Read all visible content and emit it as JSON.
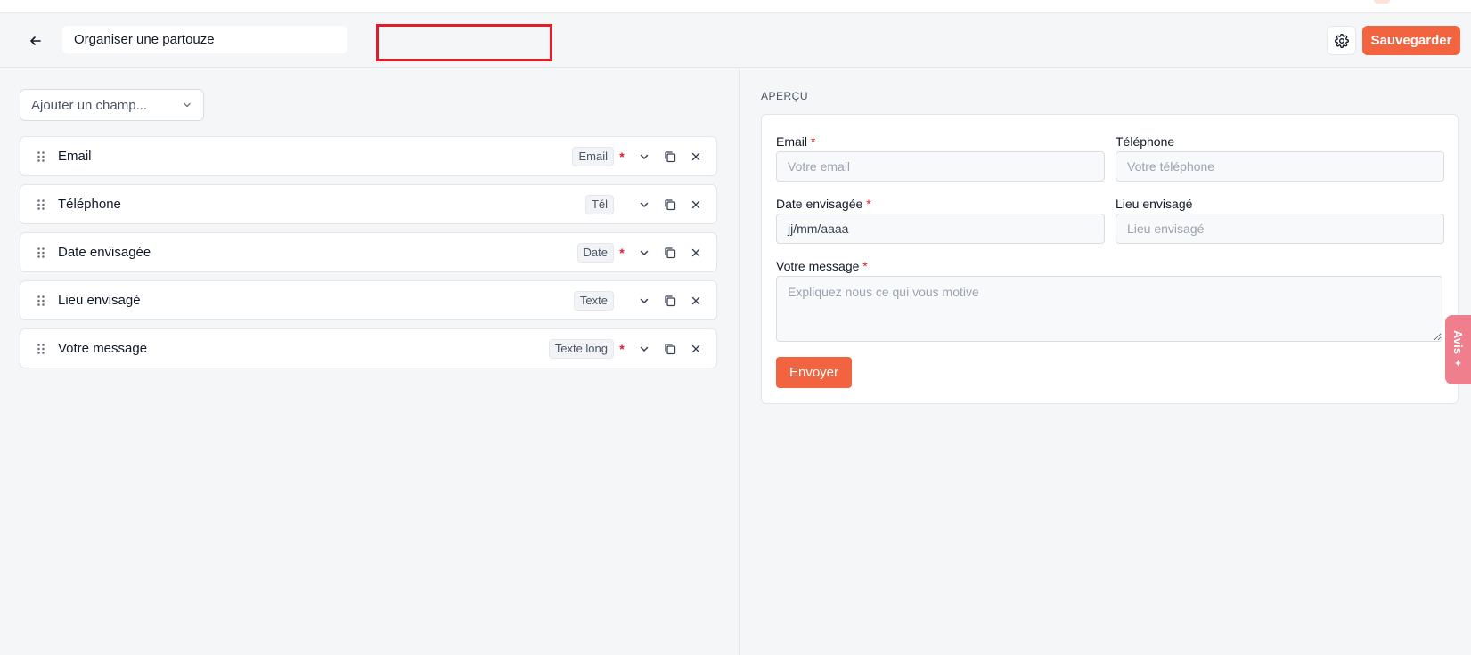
{
  "header": {
    "title_value": "Organiser une partouze",
    "save_label": "Sauvegarder"
  },
  "editor": {
    "add_field_label": "Ajouter un champ...",
    "fields": [
      {
        "label": "Email",
        "type": "Email",
        "required": true
      },
      {
        "label": "Téléphone",
        "type": "Tél",
        "required": false
      },
      {
        "label": "Date envisagée",
        "type": "Date",
        "required": true
      },
      {
        "label": "Lieu envisagé",
        "type": "Texte",
        "required": false
      },
      {
        "label": "Votre message",
        "type": "Texte long",
        "required": true
      }
    ],
    "required_mark": "*"
  },
  "preview": {
    "title": "APERÇU",
    "email_label": "Email",
    "email_placeholder": "Votre email",
    "phone_label": "Téléphone",
    "phone_placeholder": "Votre téléphone",
    "date_label": "Date envisagée",
    "date_placeholder": "jj/mm/aaaa",
    "place_label": "Lieu envisagé",
    "place_placeholder": "Lieu envisagé",
    "message_label": "Votre message",
    "message_placeholder": "Expliquez nous ce qui vous motive",
    "required_mark": "*",
    "send_label": "Envoyer"
  },
  "feedback_tab": {
    "label": "Avis"
  },
  "colors": {
    "accent": "#f26440",
    "required": "#e11d2a",
    "highlight_box": "#e11d2a",
    "feedback_tab": "#ef7f8c"
  }
}
